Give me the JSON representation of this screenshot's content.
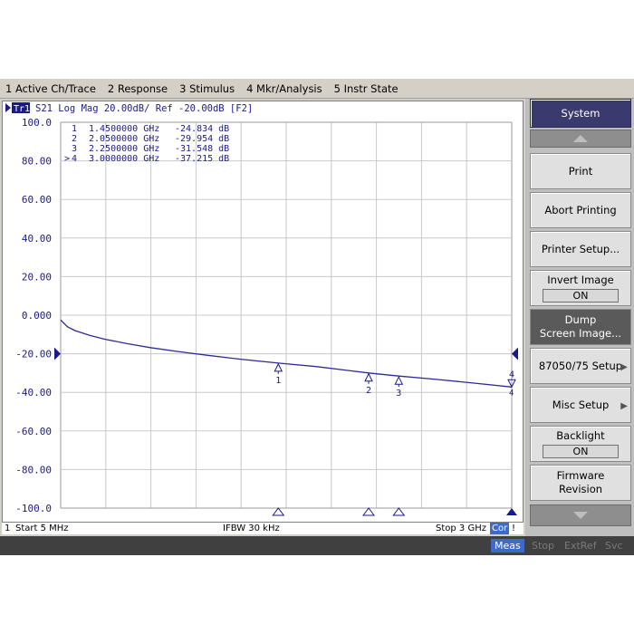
{
  "menu": [
    "1 Active Ch/Trace",
    "2 Response",
    "3 Stimulus",
    "4 Mkr/Analysis",
    "5 Instr State"
  ],
  "trace_header": {
    "badge": "Tr1",
    "text": "S21  Log Mag 20.00dB/ Ref -20.00dB [F2]"
  },
  "markers": [
    {
      "id": "1",
      "prefix": " ",
      "freq_text": "1.4500000 GHz",
      "value_text": "-24.834 dB"
    },
    {
      "id": "2",
      "prefix": " ",
      "freq_text": "2.0500000 GHz",
      "value_text": "-29.954 dB"
    },
    {
      "id": "3",
      "prefix": " ",
      "freq_text": "2.2500000 GHz",
      "value_text": "-31.548 dB"
    },
    {
      "id": "4",
      "prefix": ">",
      "freq_text": "3.0000000 GHz",
      "value_text": "-37.215 dB"
    }
  ],
  "chart_data": {
    "type": "line",
    "title": "S21 Log Mag 20.00dB/ Ref -20.00dB [F2]",
    "xlim": [
      0.005,
      3.0
    ],
    "x_unit": "GHz",
    "ylim": [
      -100,
      100
    ],
    "yticks": [
      100,
      80,
      60,
      40,
      20,
      0,
      -20,
      -40,
      -60,
      -80,
      -100
    ],
    "ytick_labels": [
      "100.0",
      "80.00",
      "60.00",
      "40.00",
      "20.00",
      "0.000",
      "-20.00",
      "-40.00",
      "-60.00",
      "-80.00",
      "-100.0"
    ],
    "x_divisions": 10,
    "reference_level": -20,
    "grid": true,
    "series": [
      {
        "color": "#2b2b9a",
        "x": [
          0.005,
          0.05,
          0.1,
          0.2,
          0.3,
          0.45,
          0.6,
          0.8,
          1.0,
          1.2,
          1.45,
          1.7,
          2.05,
          2.25,
          2.5,
          2.75,
          3.0
        ],
        "y": [
          -2.5,
          -6.0,
          -8.0,
          -10.5,
          -12.5,
          -14.8,
          -16.8,
          -19.0,
          -21.0,
          -22.8,
          -24.834,
          -26.6,
          -29.954,
          -31.548,
          -33.3,
          -35.2,
          -37.215
        ]
      }
    ],
    "marker_points": [
      {
        "label": "1",
        "x": 1.45,
        "y": -24.834
      },
      {
        "label": "2",
        "x": 2.05,
        "y": -29.954
      },
      {
        "label": "3",
        "x": 2.25,
        "y": -31.548
      },
      {
        "label": "4",
        "x": 3.0,
        "y": -37.215
      }
    ]
  },
  "status": {
    "channel": "1",
    "start": "Start 5 MHz",
    "ifbw": "IFBW 30 kHz",
    "stop": "Stop 3 GHz",
    "cor": "Cor",
    "excl": "!"
  },
  "indicators": [
    {
      "label": "Meas",
      "active": true
    },
    {
      "label": "Stop",
      "active": false
    },
    {
      "label": "ExtRef",
      "active": false
    },
    {
      "label": "Svc",
      "active": false
    }
  ],
  "softkeys": {
    "title": "System",
    "print": "Print",
    "abort": "Abort Printing",
    "printer_setup": "Printer Setup...",
    "invert_image": "Invert Image",
    "invert_image_value": "ON",
    "dump_line1": "Dump",
    "dump_line2": "Screen Image...",
    "setup_87050": "87050/75 Setup",
    "misc_setup": "Misc Setup",
    "backlight": "Backlight",
    "backlight_value": "ON",
    "firmware_line1": "Firmware",
    "firmware_line2": "Revision"
  },
  "colors": {
    "trace": "#2b2b9a",
    "grid": "#c8c8c8",
    "softkey_title": "#3a3a6e",
    "meas_indicator": "#3f6ac6"
  }
}
